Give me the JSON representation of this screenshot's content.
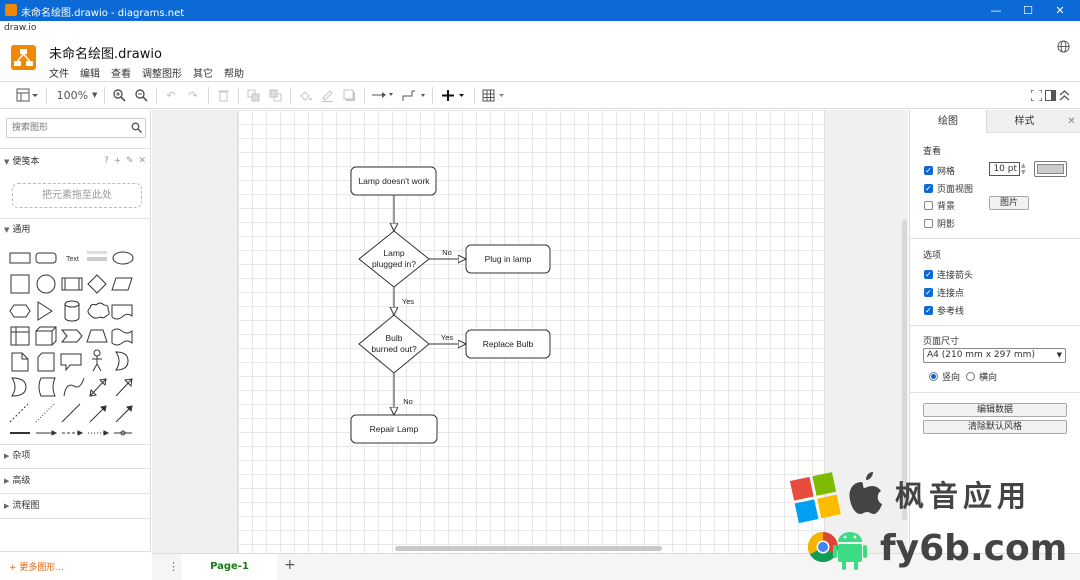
{
  "window": {
    "title": "未命名绘图.drawio - diagrams.net",
    "app_label": "draw.io",
    "minimize": "—",
    "maximize": "☐",
    "close": "✕"
  },
  "header": {
    "filename": "未命名绘图.drawio",
    "menu": [
      "文件",
      "编辑",
      "查看",
      "调整图形",
      "其它",
      "帮助"
    ]
  },
  "toolbar": {
    "zoom": "100%"
  },
  "sidebar": {
    "search_placeholder": "搜索图形",
    "scratchpad_title": "便笺本",
    "scratchpad_icons": "? + ✎ ✕",
    "drop_hint": "把元素拖至此处",
    "general_title": "通用",
    "text_shape_label": "Text",
    "sections": [
      "杂项",
      "高级",
      "流程图"
    ],
    "more_shapes": "+ 更多图形..."
  },
  "diagram": {
    "nodes": [
      "Lamp doesn't work",
      "Lamp plugged in?",
      "Plug in lamp",
      "Bulb burned out?",
      "Replace Bulb",
      "Repair Lamp"
    ],
    "edge_labels": [
      "No",
      "Yes",
      "Yes",
      "No"
    ]
  },
  "bottom": {
    "page_tab": "Page-1",
    "add_page": "+",
    "page_menu": "⋮"
  },
  "format_panel": {
    "tabs": [
      "绘图",
      "样式"
    ],
    "close": "✕",
    "view_title": "查看",
    "grid_label": "网格",
    "grid_size": "10 pt",
    "page_view_label": "页面视图",
    "background_label": "背景",
    "image_button": "图片",
    "shadow_label": "阴影",
    "options_title": "选项",
    "connection_arrows_label": "连接箭头",
    "connection_points_label": "连接点",
    "guides_label": "参考线",
    "page_size_title": "页面尺寸",
    "paper_size": "A4 (210 mm x 297 mm)",
    "portrait_label": "竖向",
    "landscape_label": "横向",
    "edit_data_button": "编辑数据",
    "clear_style_button": "清除默认风格",
    "grid_checked": true,
    "page_view_checked": true,
    "background_checked": false,
    "shadow_checked": false,
    "connection_arrows_checked": true,
    "connection_points_checked": true,
    "guides_checked": true,
    "orientation": "portrait"
  },
  "watermark": {
    "line1": "枫音应用",
    "line2": "fy6b.com"
  },
  "colors": {
    "titlebar": "#0b6ad6",
    "logo": "#f08705",
    "accent": "#0b6ad6",
    "page_tab_text": "#1a7b1a",
    "more_shapes": "#e8650c"
  }
}
